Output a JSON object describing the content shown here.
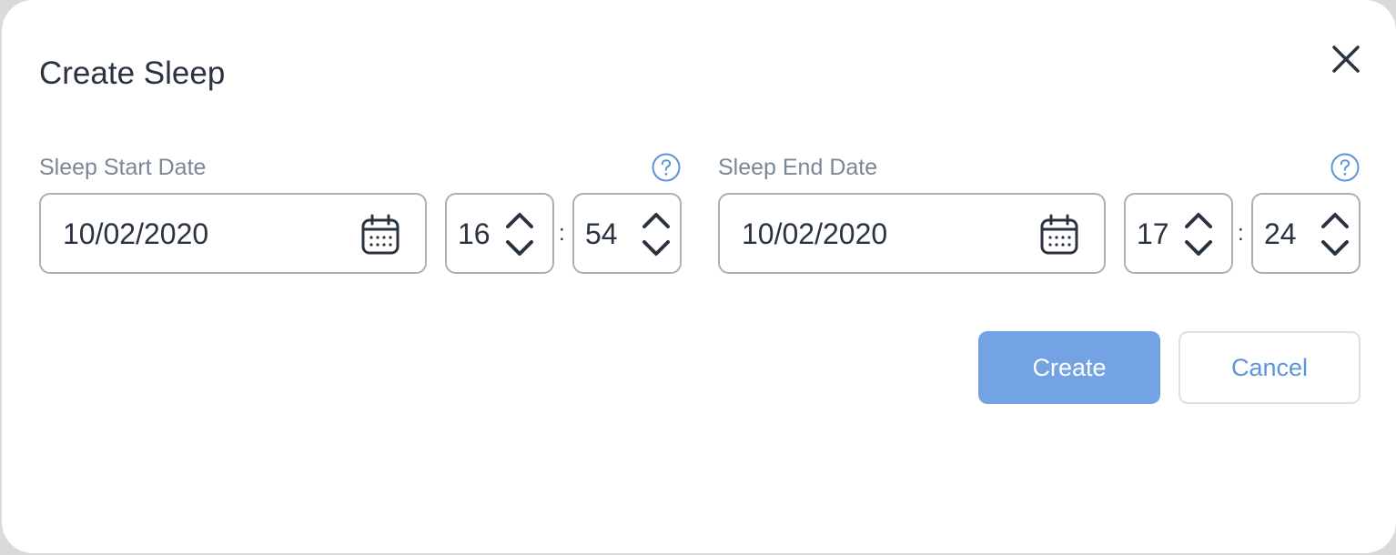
{
  "dialog": {
    "title": "Create Sleep",
    "close_icon": "close-icon"
  },
  "start": {
    "label": "Sleep Start Date",
    "help_icon": "help-icon",
    "date": "10/02/2020",
    "calendar_icon": "calendar-icon",
    "hour": "16",
    "minute": "54",
    "separator": ":"
  },
  "end": {
    "label": "Sleep End Date",
    "help_icon": "help-icon",
    "date": "10/02/2020",
    "calendar_icon": "calendar-icon",
    "hour": "17",
    "minute": "24",
    "separator": ":"
  },
  "actions": {
    "create_label": "Create",
    "cancel_label": "Cancel"
  },
  "colors": {
    "primary": "#74a3e3",
    "link": "#5b95dd",
    "text": "#2a3441",
    "label": "#7c8796",
    "border": "#a8b0ba"
  }
}
